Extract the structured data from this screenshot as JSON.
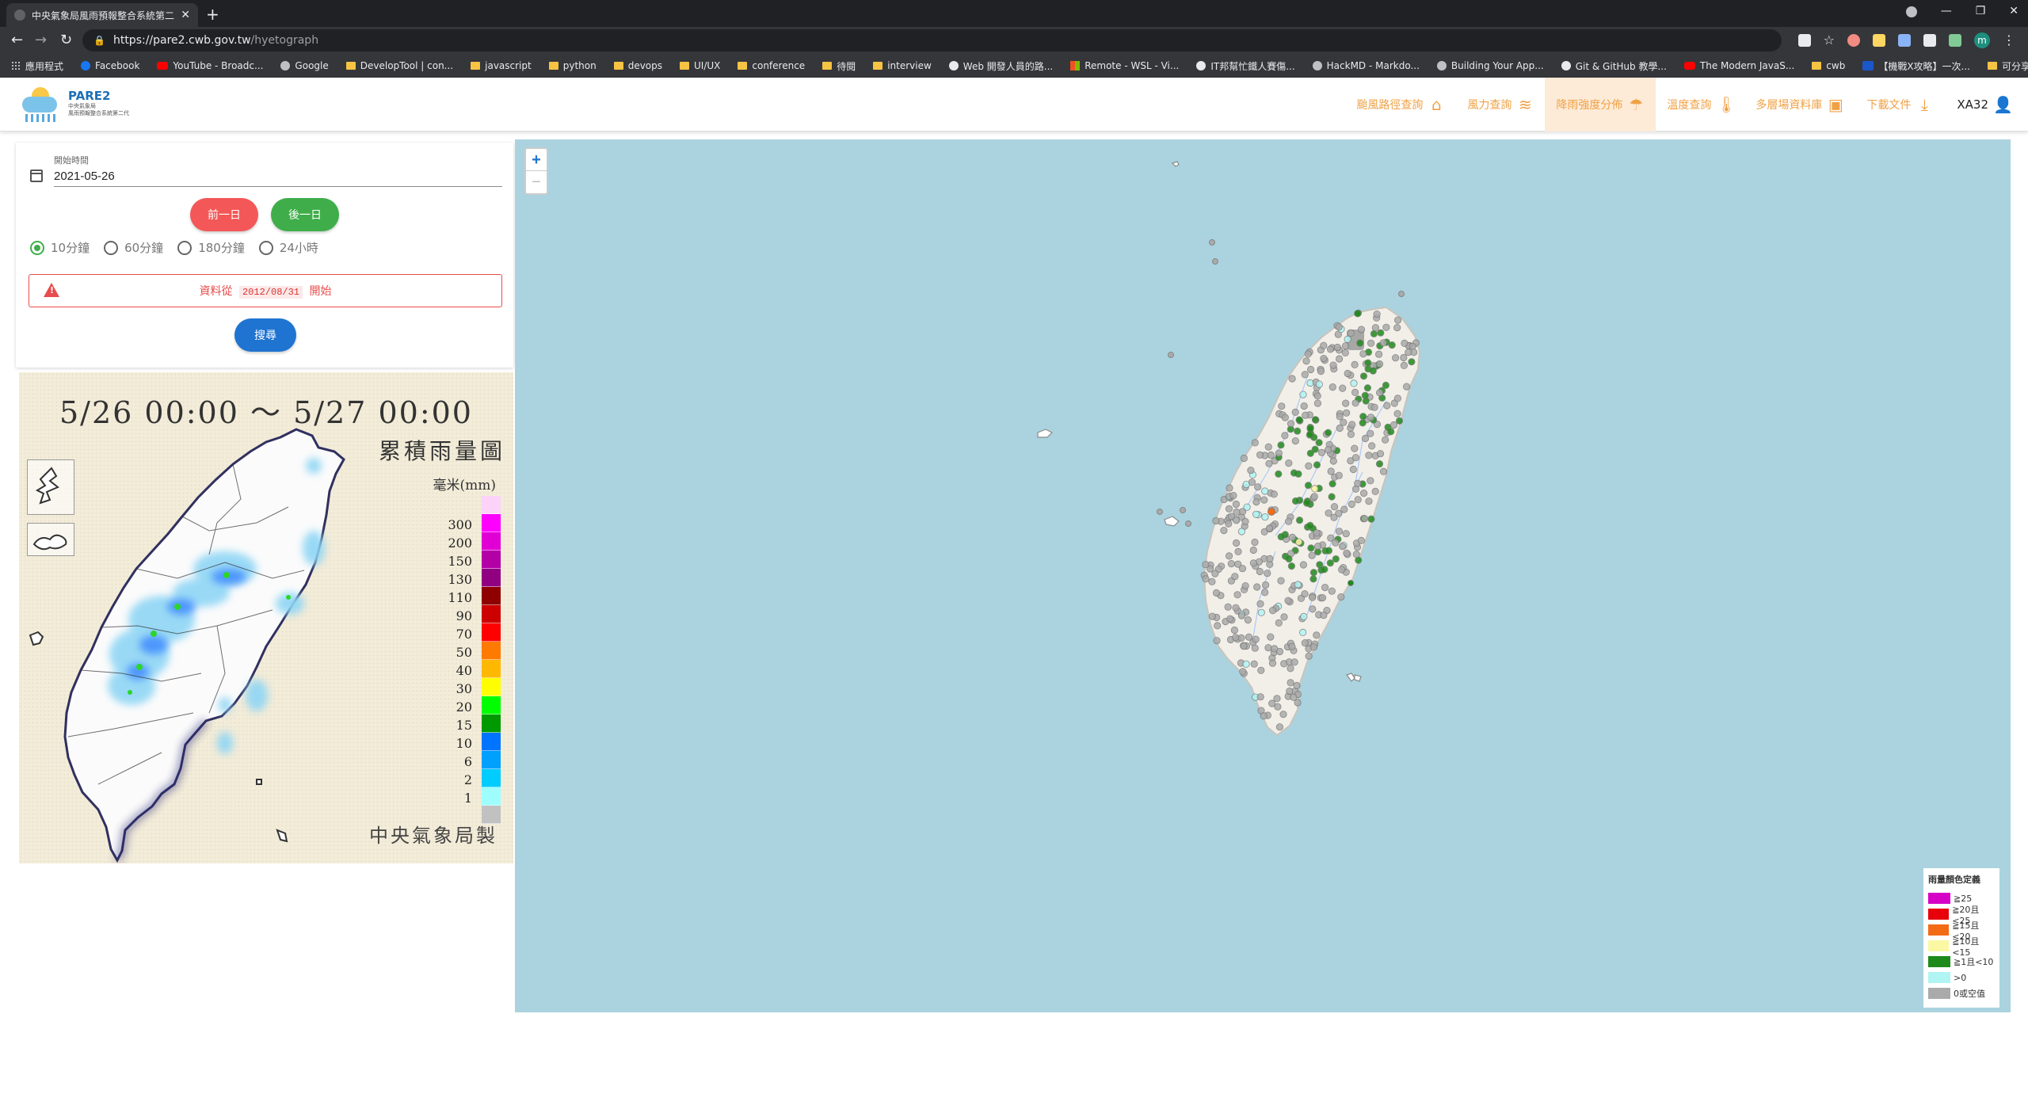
{
  "browser": {
    "tab_title": "中央氣象局風雨預報整合系統第二",
    "url_host": "https://pare2.cwb.gov.tw",
    "url_path": "/hyetograph",
    "bookmarks": [
      {
        "icon": "grid",
        "label": "應用程式"
      },
      {
        "icon": "fb",
        "label": "Facebook"
      },
      {
        "icon": "yt",
        "label": "YouTube - Broadc..."
      },
      {
        "icon": "gico",
        "label": "Google"
      },
      {
        "icon": "folder",
        "label": "DevelopTool | con..."
      },
      {
        "icon": "folder",
        "label": "javascript"
      },
      {
        "icon": "folder",
        "label": "python"
      },
      {
        "icon": "folder",
        "label": "devops"
      },
      {
        "icon": "folder",
        "label": "UI/UX"
      },
      {
        "icon": "folder",
        "label": "conference"
      },
      {
        "icon": "folder",
        "label": "待閱"
      },
      {
        "icon": "folder",
        "label": "interview"
      },
      {
        "icon": "gh",
        "label": "Web 開發人員的路..."
      },
      {
        "icon": "ms",
        "label": "Remote - WSL - Vi..."
      },
      {
        "icon": "gh",
        "label": "IT邦幫忙鐵人賽傷..."
      },
      {
        "icon": "gico",
        "label": "HackMD - Markdo..."
      },
      {
        "icon": "gico",
        "label": "Building Your App..."
      },
      {
        "icon": "gh",
        "label": "Git & GitHub 教學..."
      },
      {
        "icon": "yt",
        "label": "The Modern JavaS..."
      },
      {
        "icon": "folder",
        "label": "cwb"
      },
      {
        "icon": "ci",
        "label": "【機戰X攻略】一次..."
      },
      {
        "icon": "folder",
        "label": "可分享"
      }
    ]
  },
  "app": {
    "logo_name": "PARE2",
    "logo_sub1": "中央氣象局",
    "logo_sub2": "風雨預報整合系統第二代",
    "menu": [
      {
        "label": "颱風路徑查詢",
        "icon": "house-icon",
        "glyph": "⌂",
        "active": false
      },
      {
        "label": "風力查詢",
        "icon": "wind-icon",
        "glyph": "≋",
        "active": false
      },
      {
        "label": "降雨強度分佈",
        "icon": "rain-cloud-icon",
        "glyph": "☂",
        "active": true
      },
      {
        "label": "溫度查詢",
        "icon": "thermometer-icon",
        "glyph": "🌡",
        "active": false
      },
      {
        "label": "多層場資料庫",
        "icon": "image-icon",
        "glyph": "▣",
        "active": false
      },
      {
        "label": "下載文件",
        "icon": "download-icon",
        "glyph": "⤓",
        "active": false
      }
    ],
    "user": "XA32"
  },
  "form": {
    "date_label": "開始時間",
    "date_value": "2021-05-26",
    "prev_label": "前一日",
    "next_label": "後一日",
    "intervals": [
      {
        "label": "10分鐘",
        "checked": true
      },
      {
        "label": "60分鐘",
        "checked": false
      },
      {
        "label": "180分鐘",
        "checked": false
      },
      {
        "label": "24小時",
        "checked": false
      }
    ],
    "alert_pre": "資料從",
    "alert_date": "2012/08/31",
    "alert_post": "開始",
    "search_label": "搜尋"
  },
  "rain_image": {
    "period": "5/26 00:00 ～ 5/27 00:00",
    "title": "累積雨量圖",
    "unit": "毫米(mm)",
    "credit": "中央氣象局製",
    "scale": [
      {
        "label": "",
        "color": "#fbd3f8"
      },
      {
        "label": "300",
        "color": "#fe00fe"
      },
      {
        "label": "200",
        "color": "#e000d5"
      },
      {
        "label": "150",
        "color": "#b300a6"
      },
      {
        "label": "130",
        "color": "#900080"
      },
      {
        "label": "110",
        "color": "#8f0000"
      },
      {
        "label": "90",
        "color": "#cd0000"
      },
      {
        "label": "70",
        "color": "#fe0000"
      },
      {
        "label": "50",
        "color": "#fe7a00"
      },
      {
        "label": "40",
        "color": "#feb800"
      },
      {
        "label": "30",
        "color": "#fefe00"
      },
      {
        "label": "20",
        "color": "#00fe00"
      },
      {
        "label": "15",
        "color": "#009900"
      },
      {
        "label": "10",
        "color": "#0074fe"
      },
      {
        "label": "6",
        "color": "#00a0fe"
      },
      {
        "label": "2",
        "color": "#00ccfe"
      },
      {
        "label": "1",
        "color": "#9efefe"
      },
      {
        "label": "",
        "color": "#c1c1c1"
      }
    ]
  },
  "map": {
    "zoom_in": "+",
    "zoom_out": "−",
    "legend_title": "雨量顏色定義",
    "legend": [
      {
        "label": "≧25",
        "color": "#d600c6"
      },
      {
        "label": "≧20且<25",
        "color": "#e8000b"
      },
      {
        "label": "≧15且<20",
        "color": "#f46b16"
      },
      {
        "label": "≧10且<15",
        "color": "#fbf8a4"
      },
      {
        "label": "≧1且<10",
        "color": "#1f8a1c"
      },
      {
        "label": ">0",
        "color": "#b0f4f4"
      },
      {
        "label": "0或空值",
        "color": "#aaaaaa"
      }
    ]
  }
}
